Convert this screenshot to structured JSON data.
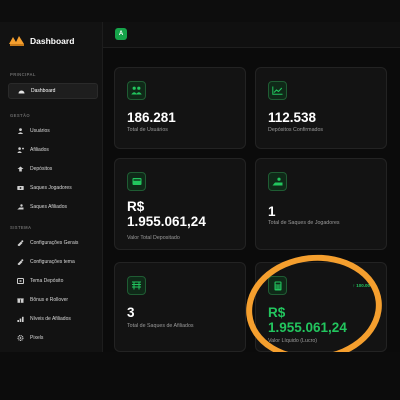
{
  "app": {
    "title": "Dashboard",
    "avatar_initial": "A"
  },
  "sidebar": {
    "section_principal": "PRINCIPAL",
    "section_gestao": "GESTÃO",
    "section_sistema": "SISTEMA",
    "dashboard": "Dashboard",
    "gestao": [
      "Usuários",
      "Afiliados",
      "Depósitos",
      "Saques Jogadores",
      "Saques Afiliados"
    ],
    "sistema": [
      "Configurações Gerais",
      "Configurações tema",
      "Tema Depósito",
      "Bônus e Rollover",
      "Níveis de Afiliados",
      "Pixels"
    ]
  },
  "cards": [
    {
      "value": "186.281",
      "label": "Total de Usuários",
      "icon": "users-icon"
    },
    {
      "value": "112.538",
      "label": "Depósitos Confirmados",
      "icon": "chart-line-icon"
    },
    {
      "value": "R$\n1.955.061,24",
      "label": "Valor Total Depositado",
      "icon": "wallet-icon"
    },
    {
      "value": "1",
      "label": "Total de Saques de Jogadores",
      "icon": "hand-coin-icon"
    },
    {
      "value": "3",
      "label": "Total de Saques de Afiliados",
      "icon": "affiliate-withdraw-icon"
    },
    {
      "value": "R$\n1.955.061,24",
      "label": "Valor Líquido (Lucro)",
      "icon": "calculator-icon",
      "trend": "↑ 100.00%"
    }
  ],
  "colors": {
    "accent": "#22c55e",
    "highlight": "#f59f2e"
  }
}
